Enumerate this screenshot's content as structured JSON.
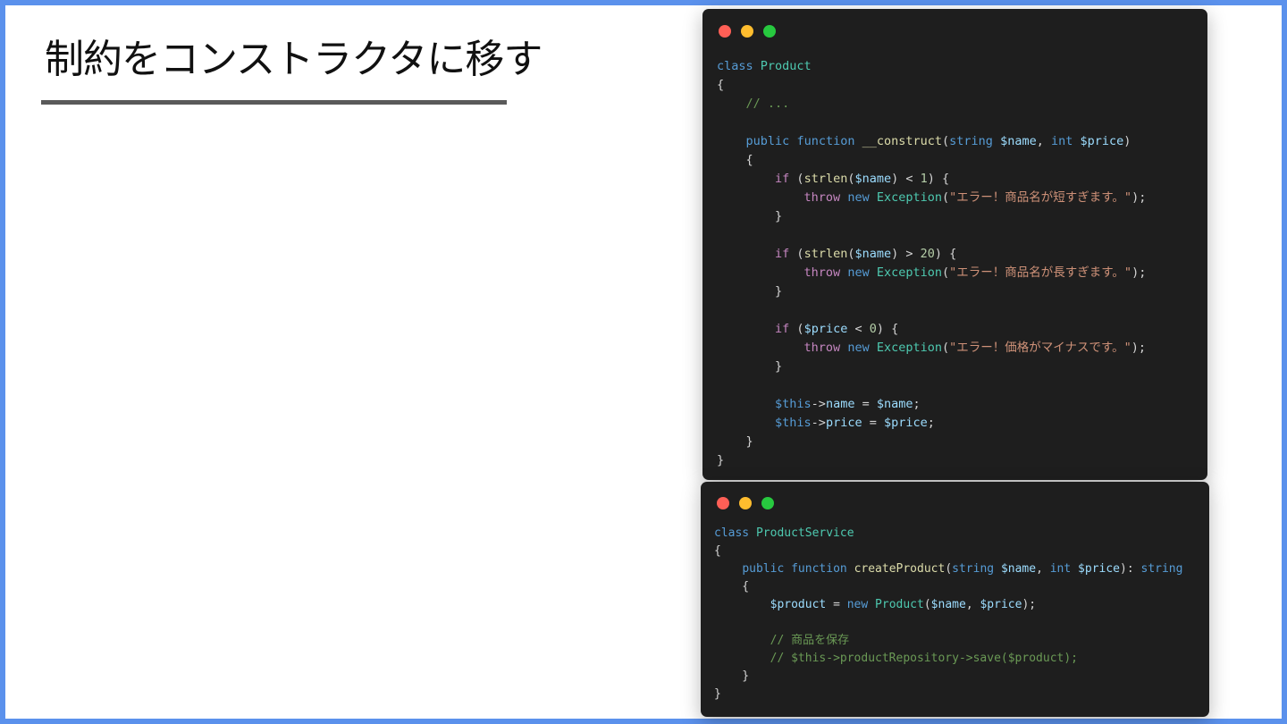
{
  "slide": {
    "title": "制約をコンストラクタに移す",
    "colors": {
      "frame": "#5b91ec",
      "rule": "#5a5a5a",
      "code_bg": "#1e1e1e"
    }
  },
  "code_windows": [
    {
      "name": "product-class",
      "lines": [
        [
          [
            "kw",
            "class"
          ],
          [
            "pn",
            " "
          ],
          [
            "cls",
            "Product"
          ]
        ],
        [
          [
            "pn",
            "{"
          ]
        ],
        [
          [
            "pn",
            "    "
          ],
          [
            "cmt",
            "// ..."
          ]
        ],
        [],
        [
          [
            "pn",
            "    "
          ],
          [
            "kw",
            "public"
          ],
          [
            "pn",
            " "
          ],
          [
            "kw",
            "function"
          ],
          [
            "pn",
            " "
          ],
          [
            "fn",
            "__construct"
          ],
          [
            "pn",
            "("
          ],
          [
            "kw",
            "string"
          ],
          [
            "pn",
            " "
          ],
          [
            "var",
            "$name"
          ],
          [
            "pn",
            ", "
          ],
          [
            "kw",
            "int"
          ],
          [
            "pn",
            " "
          ],
          [
            "var",
            "$price"
          ],
          [
            "pn",
            ")"
          ]
        ],
        [
          [
            "pn",
            "    {"
          ]
        ],
        [
          [
            "pn",
            "        "
          ],
          [
            "ctl",
            "if"
          ],
          [
            "pn",
            " ("
          ],
          [
            "fn",
            "strlen"
          ],
          [
            "pn",
            "("
          ],
          [
            "var",
            "$name"
          ],
          [
            "pn",
            ") < "
          ],
          [
            "num",
            "1"
          ],
          [
            "pn",
            ") {"
          ]
        ],
        [
          [
            "pn",
            "            "
          ],
          [
            "ctl",
            "throw"
          ],
          [
            "pn",
            " "
          ],
          [
            "kw",
            "new"
          ],
          [
            "pn",
            " "
          ],
          [
            "cls",
            "Exception"
          ],
          [
            "pn",
            "("
          ],
          [
            "str",
            "\"エラー！商品名が短すぎます。\""
          ],
          [
            "pn",
            ");"
          ]
        ],
        [
          [
            "pn",
            "        }"
          ]
        ],
        [],
        [
          [
            "pn",
            "        "
          ],
          [
            "ctl",
            "if"
          ],
          [
            "pn",
            " ("
          ],
          [
            "fn",
            "strlen"
          ],
          [
            "pn",
            "("
          ],
          [
            "var",
            "$name"
          ],
          [
            "pn",
            ") > "
          ],
          [
            "num",
            "20"
          ],
          [
            "pn",
            ") {"
          ]
        ],
        [
          [
            "pn",
            "            "
          ],
          [
            "ctl",
            "throw"
          ],
          [
            "pn",
            " "
          ],
          [
            "kw",
            "new"
          ],
          [
            "pn",
            " "
          ],
          [
            "cls",
            "Exception"
          ],
          [
            "pn",
            "("
          ],
          [
            "str",
            "\"エラー！商品名が長すぎます。\""
          ],
          [
            "pn",
            ");"
          ]
        ],
        [
          [
            "pn",
            "        }"
          ]
        ],
        [],
        [
          [
            "pn",
            "        "
          ],
          [
            "ctl",
            "if"
          ],
          [
            "pn",
            " ("
          ],
          [
            "var",
            "$price"
          ],
          [
            "pn",
            " < "
          ],
          [
            "num",
            "0"
          ],
          [
            "pn",
            ") {"
          ]
        ],
        [
          [
            "pn",
            "            "
          ],
          [
            "ctl",
            "throw"
          ],
          [
            "pn",
            " "
          ],
          [
            "kw",
            "new"
          ],
          [
            "pn",
            " "
          ],
          [
            "cls",
            "Exception"
          ],
          [
            "pn",
            "("
          ],
          [
            "str",
            "\"エラー！価格がマイナスです。\""
          ],
          [
            "pn",
            ");"
          ]
        ],
        [
          [
            "pn",
            "        }"
          ]
        ],
        [],
        [
          [
            "pn",
            "        "
          ],
          [
            "kw",
            "$this"
          ],
          [
            "pn",
            "->"
          ],
          [
            "var",
            "name"
          ],
          [
            "pn",
            " = "
          ],
          [
            "var",
            "$name"
          ],
          [
            "pn",
            ";"
          ]
        ],
        [
          [
            "pn",
            "        "
          ],
          [
            "kw",
            "$this"
          ],
          [
            "pn",
            "->"
          ],
          [
            "var",
            "price"
          ],
          [
            "pn",
            " = "
          ],
          [
            "var",
            "$price"
          ],
          [
            "pn",
            ";"
          ]
        ],
        [
          [
            "pn",
            "    }"
          ]
        ],
        [
          [
            "pn",
            "}"
          ]
        ]
      ]
    },
    {
      "name": "product-service-class",
      "lines": [
        [
          [
            "kw",
            "class"
          ],
          [
            "pn",
            " "
          ],
          [
            "cls",
            "ProductService"
          ]
        ],
        [
          [
            "pn",
            "{"
          ]
        ],
        [
          [
            "pn",
            "    "
          ],
          [
            "kw",
            "public"
          ],
          [
            "pn",
            " "
          ],
          [
            "kw",
            "function"
          ],
          [
            "pn",
            " "
          ],
          [
            "fn",
            "createProduct"
          ],
          [
            "pn",
            "("
          ],
          [
            "kw",
            "string"
          ],
          [
            "pn",
            " "
          ],
          [
            "var",
            "$name"
          ],
          [
            "pn",
            ", "
          ],
          [
            "kw",
            "int"
          ],
          [
            "pn",
            " "
          ],
          [
            "var",
            "$price"
          ],
          [
            "pn",
            "): "
          ],
          [
            "kw",
            "string"
          ]
        ],
        [
          [
            "pn",
            "    {"
          ]
        ],
        [
          [
            "pn",
            "        "
          ],
          [
            "var",
            "$product"
          ],
          [
            "pn",
            " = "
          ],
          [
            "kw",
            "new"
          ],
          [
            "pn",
            " "
          ],
          [
            "cls",
            "Product"
          ],
          [
            "pn",
            "("
          ],
          [
            "var",
            "$name"
          ],
          [
            "pn",
            ", "
          ],
          [
            "var",
            "$price"
          ],
          [
            "pn",
            ");"
          ]
        ],
        [],
        [
          [
            "pn",
            "        "
          ],
          [
            "cmt",
            "// 商品を保存"
          ]
        ],
        [
          [
            "pn",
            "        "
          ],
          [
            "cmt",
            "// $this->productRepository->save($product);"
          ]
        ],
        [
          [
            "pn",
            "    }"
          ]
        ],
        [
          [
            "pn",
            "}"
          ]
        ]
      ]
    }
  ]
}
